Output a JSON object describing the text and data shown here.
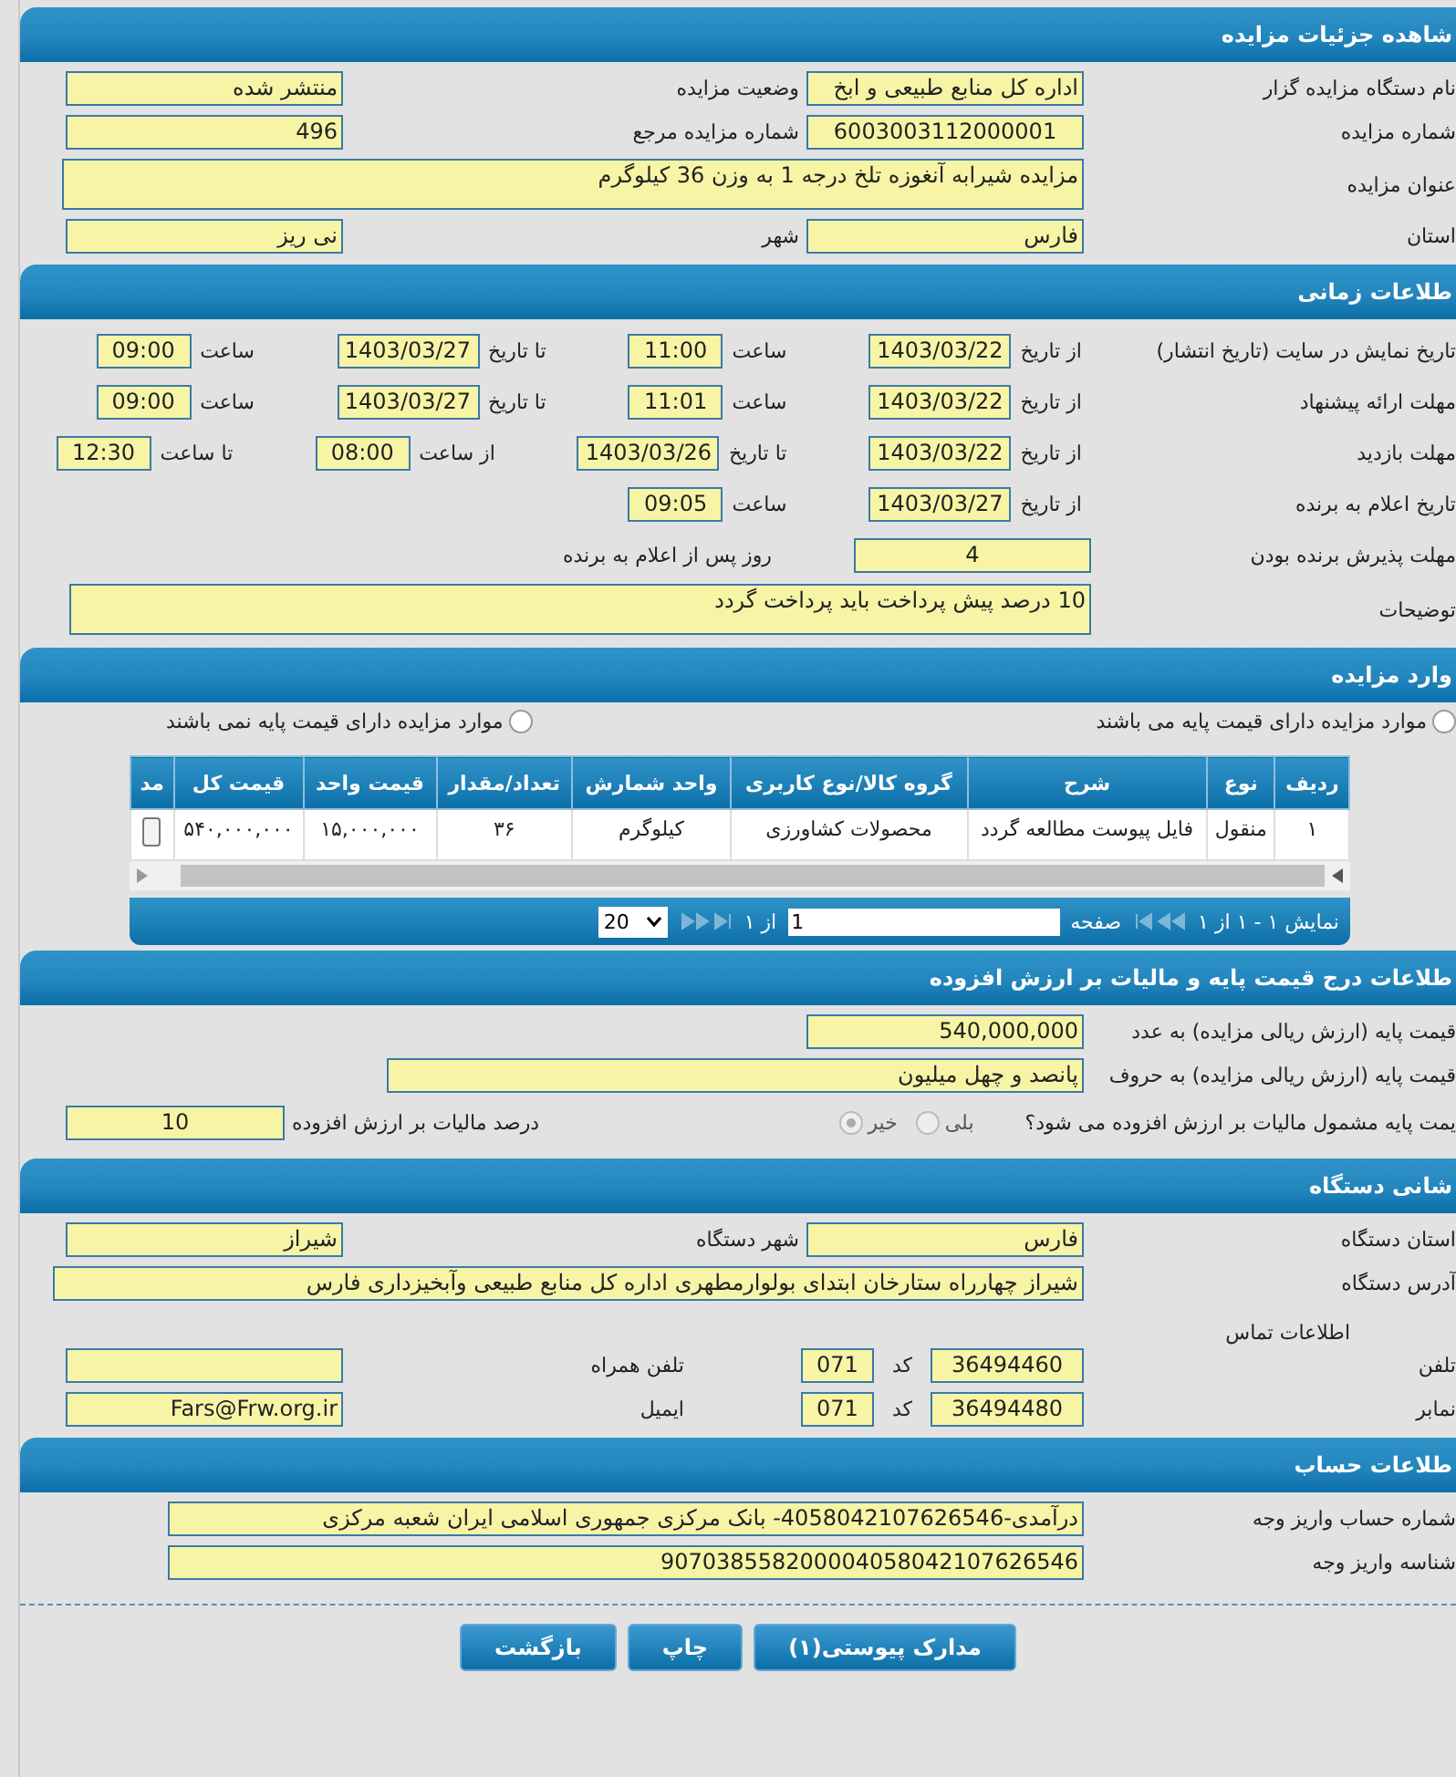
{
  "details": {
    "title": "شاهده جزئیات مزایده",
    "fields": [
      {
        "kind": "half",
        "label": "نام دستگاه مزایده گزار",
        "value": "اداره کل منابع طبیعی و ابخ",
        "centered": false
      },
      {
        "kind": "half",
        "label": "وضعیت مزایده",
        "value": "منتشر شده",
        "centered": false
      },
      {
        "kind": "half",
        "label": "شماره مزایده",
        "value": "6003003112000001",
        "centered": true
      },
      {
        "kind": "half",
        "label": "شماره مزایده مرجع",
        "value": "496",
        "centered": false
      },
      {
        "kind": "area",
        "label": "عنوان مزایده",
        "value": "مزایده شیرابه آنغوزه تلخ درجه 1 به وزن 36 کیلوگرم",
        "centered": false
      },
      {
        "kind": "half",
        "label": "استان",
        "value": "فارس",
        "centered": false
      },
      {
        "kind": "half",
        "label": "شهر",
        "value": "نی ریز",
        "centered": false
      }
    ]
  },
  "timing": {
    "title": "طلاعات زمانی",
    "rows": [
      {
        "label": "تاریخ نمایش در سایت (تاریخ انتشار)",
        "items": [
          {
            "kind": "caption",
            "text": "از تاریخ"
          },
          {
            "kind": "date",
            "value": "1403/03/22"
          },
          {
            "kind": "caption",
            "text": "ساعت"
          },
          {
            "kind": "time",
            "value": "11:00"
          },
          {
            "kind": "caption",
            "text": "تا تاریخ"
          },
          {
            "kind": "date",
            "value": "1403/03/27"
          },
          {
            "kind": "caption",
            "text": "ساعت"
          },
          {
            "kind": "time",
            "value": "09:00"
          }
        ]
      },
      {
        "label": "مهلت ارائه پیشنهاد",
        "items": [
          {
            "kind": "caption",
            "text": "از تاریخ"
          },
          {
            "kind": "date",
            "value": "1403/03/22"
          },
          {
            "kind": "caption",
            "text": "ساعت"
          },
          {
            "kind": "time",
            "value": "11:01"
          },
          {
            "kind": "caption",
            "text": "تا تاریخ"
          },
          {
            "kind": "date",
            "value": "1403/03/27"
          },
          {
            "kind": "caption",
            "text": "ساعت"
          },
          {
            "kind": "time",
            "value": "09:00"
          }
        ]
      },
      {
        "label": "مهلت بازدید",
        "items": [
          {
            "kind": "caption",
            "text": "از تاریخ"
          },
          {
            "kind": "date",
            "value": "1403/03/22"
          },
          {
            "kind": "caption",
            "text": "تا تاریخ"
          },
          {
            "kind": "date",
            "value": "1403/03/26"
          },
          {
            "kind": "caption",
            "text": "از ساعت"
          },
          {
            "kind": "time",
            "value": "08:00"
          },
          {
            "kind": "caption",
            "text": "تا ساعت"
          },
          {
            "kind": "time",
            "value": "12:30"
          }
        ]
      },
      {
        "label": "تاریخ اعلام به برنده",
        "items": [
          {
            "kind": "caption",
            "text": "از تاریخ"
          },
          {
            "kind": "date",
            "value": "1403/03/27"
          },
          {
            "kind": "caption",
            "text": "ساعت"
          },
          {
            "kind": "time",
            "value": "09:05"
          }
        ]
      },
      {
        "label": "مهلت پذیرش برنده بودن",
        "items": [
          {
            "kind": "number",
            "value": "4"
          },
          {
            "kind": "caption",
            "text": "روز پس از اعلام به برنده"
          }
        ]
      }
    ],
    "notes": {
      "label": "توضیحات",
      "value": "10 درصد پیش پرداخت باید پرداخت گردد"
    }
  },
  "items": {
    "title": "وارد مزایده",
    "options": [
      {
        "label": "موارد مزایده دارای قیمت پایه می باشند",
        "selected": false
      },
      {
        "label": "موارد مزایده دارای قیمت پایه نمی باشند",
        "selected": false
      }
    ],
    "table": {
      "columns": [
        "ردیف",
        "نوع",
        "شرح",
        "گروه کالا/نوع کاربری",
        "واحد شمارش",
        "تعداد/مقدار",
        "قیمت واحد",
        "قیمت کل",
        "مد"
      ],
      "rows": [
        [
          "۱",
          "منقول",
          "فایل پیوست مطالعه گردد",
          "محصولات کشاورزی",
          "کیلوگرم",
          "۳۶",
          "۱۵,۰۰۰,۰۰۰",
          "۵۴۰,۰۰۰,۰۰۰"
        ]
      ]
    },
    "pager": {
      "summary": "نمایش ۱ - ۱ از ۱",
      "page_label": "صفحه",
      "page": "1",
      "of": "از ۱",
      "page_size": "20"
    }
  },
  "tax": {
    "title": "طلاعات درج قیمت پایه و مالیات بر ارزش افزوده",
    "amount": {
      "label": "قیمت پایه (ارزش ریالی مزایده) به عدد",
      "value": "540,000,000"
    },
    "words": {
      "label": "قیمت پایه (ارزش ریالی مزایده) به حروف",
      "value": "پانصد و چهل میلیون"
    },
    "question": "یمت پایه مشمول مالیات بر ارزش افزوده می شود؟",
    "choices": [
      {
        "label": "بلی",
        "selected": false,
        "disabled": true
      },
      {
        "label": "خیر",
        "selected": true,
        "disabled": true
      }
    ],
    "rate": {
      "label": "درصد مالیات بر ارزش افزوده",
      "value": "10"
    }
  },
  "device": {
    "title": "شانی دستگاه",
    "fields": [
      {
        "kind": "half",
        "label": "استان دستگاه",
        "value": "فارس",
        "centered": false
      },
      {
        "kind": "half",
        "label": "شهر دستگاه",
        "value": "شیراز",
        "centered": false
      },
      {
        "kind": "full",
        "label": "آدرس دستگاه",
        "value": "شیراز چهارراه ستارخان ابتدای بولوارمطهری اداره کل منابع طبیعی وآبخیزداری فارس",
        "centered": false
      }
    ],
    "contact_title": "اطلاعات تماس",
    "contacts": [
      {
        "label": "تلفن",
        "number": "36494460",
        "code_label": "کد",
        "code": "071",
        "other_label": "تلفن همراه"
      },
      {
        "label": "نمابر",
        "number": "36494480",
        "code_label": "کد",
        "code": "071",
        "other_label": "ایمیل",
        "other_value": "Fars@Frw.org.ir"
      }
    ]
  },
  "account": {
    "title": "طلاعات حساب",
    "fields": [
      {
        "label": "شماره حساب واریز وجه",
        "value": "درآمدی-4058042107626546- بانک مرکزی جمهوری اسلامی ایران شعبه مرکزی"
      },
      {
        "label": "شناسه واریز وجه",
        "value": "907038558200004058042107626546"
      }
    ]
  },
  "buttons": [
    "مدارک پیوستی(۱)",
    "چاپ",
    "بازگشت"
  ]
}
